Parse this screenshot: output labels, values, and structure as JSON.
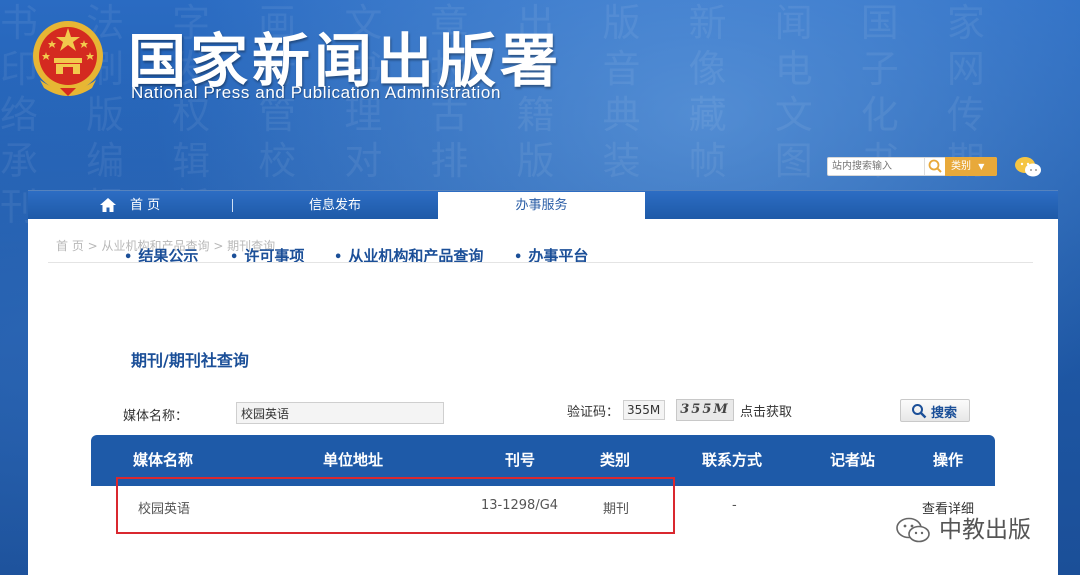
{
  "header": {
    "title_cn": "国家新闻出版署",
    "title_en": "National  Press and Publication Administration",
    "site_search": {
      "placeholder": "站内搜索输入",
      "category_label": "类别"
    }
  },
  "nav": {
    "home": "首 页",
    "info": "信息发布",
    "service": "办事服务"
  },
  "breadcrumb": "首 页 > 从业机构和产品查询 > 期刊查询",
  "subnav": [
    "结果公示",
    "许可事项",
    "从业机构和产品查询",
    "办事平台"
  ],
  "query": {
    "title": "期刊/期刊社查询",
    "media_label": "媒体名称：",
    "media_value": "校园英语",
    "captcha_label": "验证码：",
    "captcha_value": "355M",
    "captcha_image_text": "355M",
    "captcha_refresh": "点击获取",
    "search_button": "搜索"
  },
  "table": {
    "columns": [
      "媒体名称",
      "单位地址",
      "刊号",
      "类别",
      "联系方式",
      "记者站",
      "操作"
    ],
    "rows": [
      {
        "name": "校园英语",
        "address": "",
        "issn": "13-1298/G4",
        "category": "期刊",
        "contact": "-",
        "station": "",
        "action": "查看详细"
      }
    ]
  },
  "watermark": "中教出版",
  "colors": {
    "brand_blue": "#1e5aa8",
    "highlight_red": "#d9282f",
    "category_orange": "#e8a93a"
  }
}
